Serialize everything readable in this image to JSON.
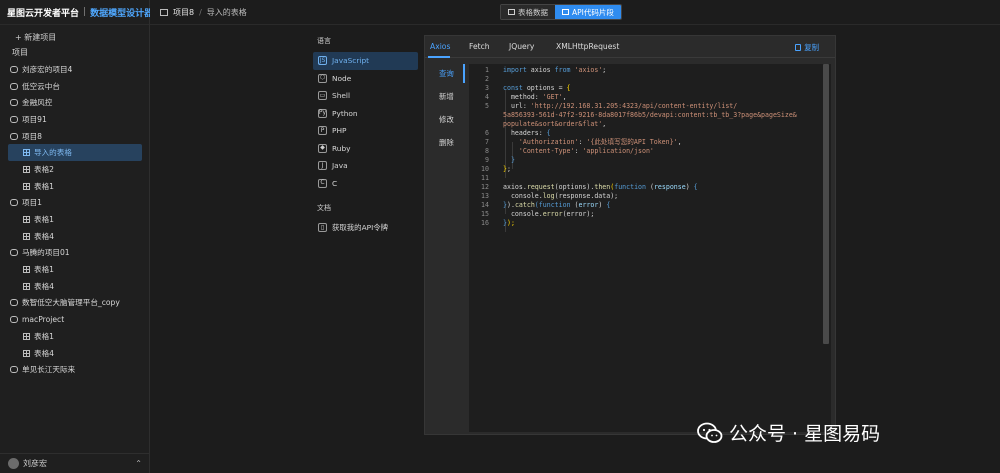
{
  "brand": {
    "title": "星图云开发者平台",
    "separator": "|",
    "subtitle": "数据模型设计器"
  },
  "sidebar": {
    "new_project": "+ 新建项目",
    "root": "项目",
    "items": [
      {
        "label": "刘彦宏的项目4",
        "level": 0,
        "type": "folder"
      },
      {
        "label": "低空云中台",
        "level": 0,
        "type": "folder"
      },
      {
        "label": "金融风控",
        "level": 0,
        "type": "folder"
      },
      {
        "label": "项目91",
        "level": 0,
        "type": "folder"
      },
      {
        "label": "项目8",
        "level": 0,
        "type": "folder"
      },
      {
        "label": "导入的表格",
        "level": 1,
        "type": "table",
        "active": true
      },
      {
        "label": "表格2",
        "level": 1,
        "type": "table"
      },
      {
        "label": "表格1",
        "level": 1,
        "type": "table"
      },
      {
        "label": "项目1",
        "level": 0,
        "type": "folder"
      },
      {
        "label": "表格1",
        "level": 1,
        "type": "table"
      },
      {
        "label": "表格4",
        "level": 1,
        "type": "table"
      },
      {
        "label": "马腾的项目01",
        "level": 0,
        "type": "folder"
      },
      {
        "label": "表格1",
        "level": 1,
        "type": "table"
      },
      {
        "label": "表格4",
        "level": 1,
        "type": "table"
      },
      {
        "label": "数智低空大脑管理平台_copy",
        "level": 0,
        "type": "folder"
      },
      {
        "label": "macProject",
        "level": 0,
        "type": "folder"
      },
      {
        "label": "表格1",
        "level": 1,
        "type": "table"
      },
      {
        "label": "表格4",
        "level": 1,
        "type": "table"
      },
      {
        "label": "单见长江天际来",
        "level": 0,
        "type": "folder"
      }
    ],
    "user": "刘彦宏"
  },
  "header": {
    "breadcrumb": [
      "项目8",
      "/",
      "导入的表格"
    ],
    "view_tabs": [
      {
        "label": "表格数据",
        "active": false
      },
      {
        "label": "API代码片段",
        "active": true
      }
    ]
  },
  "languages": {
    "title": "语言",
    "items": [
      {
        "label": "JavaScript",
        "icon": "JS",
        "active": true
      },
      {
        "label": "Node",
        "icon": "⬡"
      },
      {
        "label": "Shell",
        "icon": "▭"
      },
      {
        "label": "Python",
        "icon": "Py"
      },
      {
        "label": "PHP",
        "icon": "P"
      },
      {
        "label": "Ruby",
        "icon": "◆"
      },
      {
        "label": "Java",
        "icon": "J"
      },
      {
        "label": "C",
        "icon": "C"
      }
    ],
    "docs_title": "文档",
    "docs_link": "获取我的API令牌"
  },
  "code_panel": {
    "tabs": [
      "Axios",
      "Fetch",
      "JQuery",
      "XMLHttpRequest"
    ],
    "active_tab": "Axios",
    "copy_label": "复制",
    "methods": [
      "查询",
      "新增",
      "修改",
      "删除"
    ],
    "active_method": "查询",
    "line_numbers": [
      "1",
      "2",
      "3",
      "4",
      "5",
      "",
      "",
      "6",
      "7",
      "8",
      "9",
      "10",
      "11",
      "12",
      "13",
      "14",
      "15",
      "16"
    ]
  },
  "code": {
    "l1": [
      "import",
      " axios ",
      "from",
      " ",
      "'axios'",
      ";"
    ],
    "l3": [
      "const",
      " options = ",
      "{"
    ],
    "l4": [
      "  method: ",
      "'GET'",
      ","
    ],
    "l5a": [
      "  url: ",
      "'http://192.168.31.205:4323/api/content-entity/list/"
    ],
    "l5b": "5a856393-561d-47f2-9216-8da8017f86b5/devapi:content:tb_tb_3?page&pageSize&",
    "l5c": [
      "populate&sort&order&flat'",
      ","
    ],
    "l6": [
      "  headers: ",
      "{"
    ],
    "l7": [
      "    ",
      "'Authorization'",
      ": ",
      "'{此处填写您的API Token}'",
      ","
    ],
    "l8": [
      "    ",
      "'Content-Type'",
      ": ",
      "'application/json'"
    ],
    "l9": [
      "  ",
      "}"
    ],
    "l10": [
      "}",
      ";"
    ],
    "l12": [
      "axios",
      ".",
      "request",
      "(options).",
      "then",
      "(",
      "function",
      " (",
      "response",
      ") ",
      "{"
    ],
    "l13": [
      "  console.",
      "log",
      "(response.data);"
    ],
    "l14": [
      "}",
      ").",
      "catch",
      "(",
      "function",
      " (",
      "error",
      ") ",
      "{"
    ],
    "l15": [
      "  console.",
      "error",
      "(error);"
    ],
    "l16": [
      "}",
      ");"
    ]
  },
  "watermark": {
    "text": "公众号 · 星图易码"
  },
  "colors": {
    "accent": "#2f8cf0",
    "link": "#4aa3ff",
    "keyword": "#569cd6",
    "string": "#ce9178"
  }
}
